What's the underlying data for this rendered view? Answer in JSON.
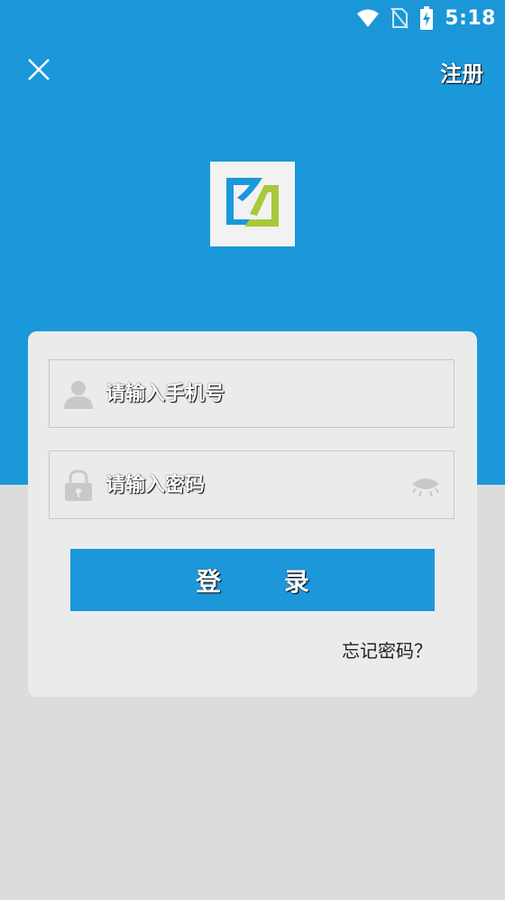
{
  "status_bar": {
    "time": "5:18",
    "icons": [
      "wifi-icon",
      "no-sim-icon",
      "battery-charging-icon"
    ]
  },
  "nav": {
    "close_icon": "close-icon",
    "register_label": "注册"
  },
  "logo": {
    "name": "app-logo",
    "colors": {
      "blue": "#1a98da",
      "green": "#a8c93a"
    }
  },
  "login_form": {
    "phone_placeholder": "请输入手机号",
    "phone_value": "",
    "password_placeholder": "请输入密码",
    "password_value": "",
    "login_button": "登 录",
    "forgot_password": "忘记密码？"
  },
  "colors": {
    "primary": "#1a98da",
    "card": "#ebebeb",
    "background": "#dcdcdc"
  }
}
